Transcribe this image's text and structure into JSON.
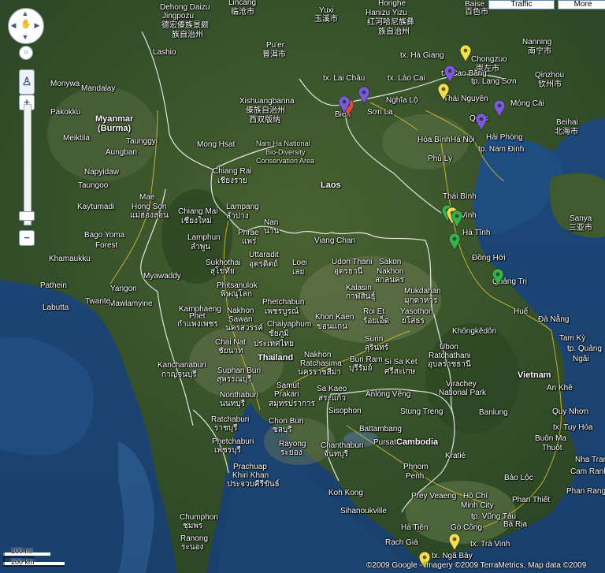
{
  "map": {
    "controls": {
      "traffic_label": "Traffic",
      "more_label": "More",
      "zoom_in": "+",
      "zoom_out": "−",
      "zoom_level_fraction": 0.93
    },
    "scale": {
      "top": "100 mi",
      "bottom": "200 km"
    },
    "copyright": "©2009 Google - Imagery ©2009 TerraMetrics, Map data ©2009",
    "colors": {
      "ocean": "#1f4d7a",
      "land": "#3d5a2a",
      "marker_red": "#e04b3a",
      "marker_purple": "#7a5ad8",
      "marker_yellow": "#f0e04a",
      "marker_green": "#34b34a"
    },
    "labels": [
      {
        "id": "dehong",
        "text": "Dehong Daizu"
      },
      {
        "id": "jingpozu",
        "text": "Jingpozu"
      },
      {
        "id": "dehong-cjk",
        "text": "德宏傣族景颇"
      },
      {
        "id": "dehong-cjk2",
        "text": "族自治州"
      },
      {
        "id": "lincang",
        "text": "Lincang"
      },
      {
        "id": "lincang-cjk",
        "text": "临沧市"
      },
      {
        "id": "yuxi",
        "text": "Yuxi"
      },
      {
        "id": "yuxi-cjk",
        "text": "玉溪市"
      },
      {
        "id": "honghe",
        "text": "Honghe"
      },
      {
        "id": "hanizu",
        "text": "Hanizu Yizu"
      },
      {
        "id": "honghe-cjk",
        "text": "红河哈尼族彝"
      },
      {
        "id": "honghe-cjk2",
        "text": "族自治州"
      },
      {
        "id": "baise",
        "text": "Baise"
      },
      {
        "id": "baise-cjk",
        "text": "百色市"
      },
      {
        "id": "lashio",
        "text": "Lashio"
      },
      {
        "id": "puer",
        "text": "Pu'er"
      },
      {
        "id": "puer-cjk",
        "text": "普洱市"
      },
      {
        "id": "chongzuo",
        "text": "Chongzuo"
      },
      {
        "id": "chongzuo-cjk",
        "text": "崇左市"
      },
      {
        "id": "nanning",
        "text": "Nanning"
      },
      {
        "id": "nanning-cjk",
        "text": "南宁市"
      },
      {
        "id": "qinzhou",
        "text": "Qinzhou"
      },
      {
        "id": "qinzhou-cjk",
        "text": "钦州市"
      },
      {
        "id": "monywa",
        "text": "Monywa"
      },
      {
        "id": "mandalay",
        "text": "Mandalay"
      },
      {
        "id": "pakokku",
        "text": "Pakokku"
      },
      {
        "id": "xishuang",
        "text": "Xishuangbanna"
      },
      {
        "id": "xishuang-cjk",
        "text": "傣族自治州"
      },
      {
        "id": "xishuang-cjk2",
        "text": "西双版纳"
      },
      {
        "id": "myanmar",
        "text": "Myanmar"
      },
      {
        "id": "burma",
        "text": "(Burma)"
      },
      {
        "id": "meiktila",
        "text": "Meiktila"
      },
      {
        "id": "taunggyi",
        "text": "Taunggyi"
      },
      {
        "id": "aungban",
        "text": "Aungban"
      },
      {
        "id": "monghsat",
        "text": "Mong Hsat"
      },
      {
        "id": "namha",
        "text": "Nam Ha National"
      },
      {
        "id": "namha2",
        "text": "Bio-Diversity"
      },
      {
        "id": "namha3",
        "text": "Conservation Area"
      },
      {
        "id": "laichau",
        "text": "tx. Lai Châu"
      },
      {
        "id": "haGiang",
        "text": "tx. Hà Giang"
      },
      {
        "id": "laocai",
        "text": "tx. Lào Cai"
      },
      {
        "id": "caoBang",
        "text": "tx. Cao Bằng"
      },
      {
        "id": "nghialo",
        "text": "Nghĩa Lộ"
      },
      {
        "id": "sonla",
        "text": "Sơn La"
      },
      {
        "id": "thainguyen",
        "text": "Thái Nguyên"
      },
      {
        "id": "langson",
        "text": "tp. Lạng Sơn"
      },
      {
        "id": "moncai",
        "text": "Móng Cái"
      },
      {
        "id": "beihai",
        "text": "Beihai"
      },
      {
        "id": "beihai-cjk",
        "text": "北海市"
      },
      {
        "id": "haiphong",
        "text": "Hải Phòng"
      },
      {
        "id": "hanoi",
        "text": "Hà Nội"
      },
      {
        "id": "hoabinh",
        "text": "Hòa Bình"
      },
      {
        "id": "namdinh",
        "text": "tp. Nam Định"
      },
      {
        "id": "phuly",
        "text": "Phủ Lý"
      },
      {
        "id": "thaibinh",
        "text": "Thái Bình"
      },
      {
        "id": "napyidaw",
        "text": "Napyidaw"
      },
      {
        "id": "chiangrai",
        "text": "Chiang Rai"
      },
      {
        "id": "chiangrai-th",
        "text": "เชียงราย"
      },
      {
        "id": "laos",
        "text": "Laos"
      },
      {
        "id": "taungoo",
        "text": "Taungoo"
      },
      {
        "id": "mae",
        "text": "Mae"
      },
      {
        "id": "hongson",
        "text": "Hong Son"
      },
      {
        "id": "hongson-th",
        "text": "แม่ฮ่องสอน"
      },
      {
        "id": "kaytumadi",
        "text": "Kaytumadi"
      },
      {
        "id": "chiangmai",
        "text": "Chiang Mai"
      },
      {
        "id": "chiangmai-th",
        "text": "เชียงใหม่"
      },
      {
        "id": "lampang",
        "text": "Lampang"
      },
      {
        "id": "lampang-th",
        "text": "ลำปาง"
      },
      {
        "id": "nan",
        "text": "Nan"
      },
      {
        "id": "nan-th",
        "text": "น่าน"
      },
      {
        "id": "phrae",
        "text": "Phrae"
      },
      {
        "id": "phrae-th",
        "text": "แพร่"
      },
      {
        "id": "vinh",
        "text": "Vinh"
      },
      {
        "id": "hatinh",
        "text": "Hà Tĩnh"
      },
      {
        "id": "donghoi",
        "text": "Đồng Hới"
      },
      {
        "id": "bagoyoma",
        "text": "Bago Yoma"
      },
      {
        "id": "forest",
        "text": "Forest"
      },
      {
        "id": "lamphun",
        "text": "Lamphun"
      },
      {
        "id": "lamphun-th",
        "text": "ลำพูน"
      },
      {
        "id": "vangchan",
        "text": "Viang Chan"
      },
      {
        "id": "khamaukku",
        "text": "Khamaukku"
      },
      {
        "id": "sukhothai",
        "text": "Sukhothai"
      },
      {
        "id": "sukhothai-th",
        "text": "สุโขทัย"
      },
      {
        "id": "uttaradit",
        "text": "Uttaradit"
      },
      {
        "id": "uttaradit-th",
        "text": "อุตรดิตถ์"
      },
      {
        "id": "loei",
        "text": "Loei"
      },
      {
        "id": "loei-th",
        "text": "เลย"
      },
      {
        "id": "udonthani",
        "text": "Udon Thani"
      },
      {
        "id": "udonthani-th",
        "text": "อุดรธานี"
      },
      {
        "id": "sakon",
        "text": "Sakon"
      },
      {
        "id": "nakhon-sk",
        "text": "Nakhon"
      },
      {
        "id": "sakon-th",
        "text": "สกลนคร"
      },
      {
        "id": "pathein",
        "text": "Pathein"
      },
      {
        "id": "yangon",
        "text": "Yangon"
      },
      {
        "id": "mawlamyine",
        "text": "Mawlamyine"
      },
      {
        "id": "myawaddy",
        "text": "Myawaddy"
      },
      {
        "id": "phitsanulok",
        "text": "Phitsanulok"
      },
      {
        "id": "phitsanulok-th",
        "text": "พิษณุโลก"
      },
      {
        "id": "quangtri",
        "text": "Quảng Trị"
      },
      {
        "id": "hue",
        "text": "Huế"
      },
      {
        "id": "danang",
        "text": "Đà Nẵng"
      },
      {
        "id": "labutta",
        "text": "Labutta"
      },
      {
        "id": "twante",
        "text": "Twante"
      },
      {
        "id": "kalasin",
        "text": "Kalasin"
      },
      {
        "id": "kalasin-th",
        "text": "กาฬสินธุ์"
      },
      {
        "id": "mukdahan",
        "text": "Mukdahan"
      },
      {
        "id": "mukdahan-th",
        "text": "มุกดาหาร"
      },
      {
        "id": "kampaeng",
        "text": "Kamphaeng"
      },
      {
        "id": "phet",
        "text": "Phet"
      },
      {
        "id": "kampaeng-th",
        "text": "กำแพงเพชร"
      },
      {
        "id": "nakhonsawan",
        "text": "Nakhon"
      },
      {
        "id": "sawan",
        "text": "Sawan"
      },
      {
        "id": "sawan-th",
        "text": "นครสวรรค์"
      },
      {
        "id": "phetchabun",
        "text": "Phetchabun"
      },
      {
        "id": "phetchabun-th",
        "text": "เพชรบูรณ์"
      },
      {
        "id": "chaiyaphum",
        "text": "Chaiyaphum"
      },
      {
        "id": "chaiyaphum-th",
        "text": "ชัยภูมิ"
      },
      {
        "id": "khonkaen",
        "text": "Khon Kaen"
      },
      {
        "id": "khonkaen-th",
        "text": "ขอนแก่น"
      },
      {
        "id": "roiet",
        "text": "Roi Et"
      },
      {
        "id": "roiet-th",
        "text": "ร้อยเอ็ด"
      },
      {
        "id": "yasothon",
        "text": "Yasothon"
      },
      {
        "id": "yasothon-th",
        "text": "ยโสธร"
      },
      {
        "id": "khongkedon",
        "text": "Khôngkêdôn"
      },
      {
        "id": "tamky",
        "text": "Tam Kỳ"
      },
      {
        "id": "quangngai",
        "text": "tp. Quảng"
      },
      {
        "id": "ngai",
        "text": "Ngãi"
      },
      {
        "id": "chainat",
        "text": "Chai Nat"
      },
      {
        "id": "chainat-th",
        "text": "ชัยนาท"
      },
      {
        "id": "thailand-th",
        "text": "ประเทศไทย"
      },
      {
        "id": "thailand",
        "text": "Thailand"
      },
      {
        "id": "nakhonrat",
        "text": "Nakhon"
      },
      {
        "id": "ratchasima",
        "text": "Ratchasima"
      },
      {
        "id": "ratchasima-th",
        "text": "นครราชสีมา"
      },
      {
        "id": "surin",
        "text": "Surin"
      },
      {
        "id": "surin-th",
        "text": "สุรินทร์"
      },
      {
        "id": "buriram",
        "text": "Buri Ram"
      },
      {
        "id": "buriram-th",
        "text": "บุรีรัมย์"
      },
      {
        "id": "sisaket",
        "text": "Si Sa Ket"
      },
      {
        "id": "sisaket-th",
        "text": "ศรีสะเกษ"
      },
      {
        "id": "ubon",
        "text": "Ubon"
      },
      {
        "id": "ratchathani",
        "text": "Ratchathani"
      },
      {
        "id": "ubon-th",
        "text": "อุบลราชธานี"
      },
      {
        "id": "kanchanaburi",
        "text": "Kanchanaburi"
      },
      {
        "id": "kanchanaburi-th",
        "text": "กาญจนบุรี"
      },
      {
        "id": "suphan",
        "text": "Suphan Buri"
      },
      {
        "id": "suphan-th",
        "text": "สุพรรณบุรี"
      },
      {
        "id": "vietnam",
        "text": "Vietnam"
      },
      {
        "id": "anke",
        "text": "An Khê"
      },
      {
        "id": "virachey",
        "text": "Virachey"
      },
      {
        "id": "nationalpark",
        "text": "National Park"
      },
      {
        "id": "nonthaburi",
        "text": "Nonthaburi"
      },
      {
        "id": "nonthaburi-th",
        "text": "นนทบุรี"
      },
      {
        "id": "samut",
        "text": "Samut"
      },
      {
        "id": "prakan",
        "text": "Prakan"
      },
      {
        "id": "prakan-th",
        "text": "สมุทรปราการ"
      },
      {
        "id": "saekaeo",
        "text": "Sa Kaeo"
      },
      {
        "id": "saekaeo-th",
        "text": "สระแก้ว"
      },
      {
        "id": "anlong",
        "text": "Ânlóng Vêng"
      },
      {
        "id": "quynhon",
        "text": "Quy Nhơn"
      },
      {
        "id": "ratchaburi",
        "text": "Ratchaburi"
      },
      {
        "id": "ratchaburi-th",
        "text": "ราชบุรี"
      },
      {
        "id": "chonburi",
        "text": "Chon Buri"
      },
      {
        "id": "chonburi-th",
        "text": "ชลบุรี"
      },
      {
        "id": "sisophon",
        "text": "Sisophon"
      },
      {
        "id": "stungtreng",
        "text": "Stung Treng"
      },
      {
        "id": "banlung",
        "text": "Banlung"
      },
      {
        "id": "tuyhoa",
        "text": "tx. Tuy Hòa"
      },
      {
        "id": "battambang",
        "text": "Battambang"
      },
      {
        "id": "cambodia",
        "text": "Cambodia"
      },
      {
        "id": "buonma",
        "text": "Buôn Ma"
      },
      {
        "id": "thuot",
        "text": "Thuột"
      },
      {
        "id": "phetchaburi",
        "text": "Phetchaburi"
      },
      {
        "id": "phetchaburi-th",
        "text": "เพชรบุรี"
      },
      {
        "id": "rayong",
        "text": "Rayong"
      },
      {
        "id": "rayong-th",
        "text": "ระยอง"
      },
      {
        "id": "chanthaburi",
        "text": "Chanthaburi"
      },
      {
        "id": "chanthaburi-th",
        "text": "จันทบุรี"
      },
      {
        "id": "pursat",
        "text": "Pursat"
      },
      {
        "id": "kratie",
        "text": "Kratié"
      },
      {
        "id": "nhatrang",
        "text": "Nha Trang"
      },
      {
        "id": "prachuap",
        "text": "Prachuap"
      },
      {
        "id": "khirikhan",
        "text": "Khiri Khan"
      },
      {
        "id": "prachuap-th",
        "text": "ประจวบคีรีขันธ์"
      },
      {
        "id": "phnom",
        "text": "Phnom"
      },
      {
        "id": "penh",
        "text": "Penh"
      },
      {
        "id": "baoloc",
        "text": "Bảo Lộc"
      },
      {
        "id": "camranh",
        "text": "Cam Ranh"
      },
      {
        "id": "kohkong",
        "text": "Koh Kong"
      },
      {
        "id": "preyveaeng",
        "text": "Prey Veaeng"
      },
      {
        "id": "hochiminh",
        "text": "Hồ Chí"
      },
      {
        "id": "minhcity",
        "text": "Minh City"
      },
      {
        "id": "phanthiet",
        "text": "Phan Thiết"
      },
      {
        "id": "phanrang",
        "text": "Phan Rang"
      },
      {
        "id": "sihanoukville",
        "text": "Sihanoukville"
      },
      {
        "id": "vungtau",
        "text": "tp. Vũng Tàu"
      },
      {
        "id": "chumphon",
        "text": "Chumphon"
      },
      {
        "id": "chumphon-th",
        "text": "ชุมพร"
      },
      {
        "id": "hatien",
        "text": "Hà Tiên"
      },
      {
        "id": "gocong",
        "text": "Gò Công"
      },
      {
        "id": "baria",
        "text": "Bà Rịa"
      },
      {
        "id": "ranong",
        "text": "Ranong"
      },
      {
        "id": "ranong-th",
        "text": "ระนอง"
      },
      {
        "id": "rachgia",
        "text": "Rạch Giá"
      },
      {
        "id": "travinh",
        "text": "tx. Trà Vinh"
      },
      {
        "id": "ngabay",
        "text": "tx. Ngã Bảy"
      },
      {
        "id": "sanya",
        "text": "Sanya"
      },
      {
        "id": "sanya-cjk",
        "text": "三亚市"
      },
      {
        "id": "bien",
        "text": "Biên"
      },
      {
        "id": "cuo",
        "text": "Quốc"
      }
    ]
  }
}
